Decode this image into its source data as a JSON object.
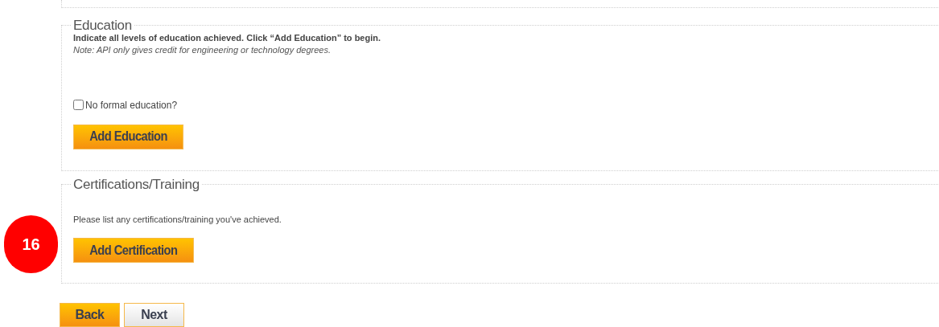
{
  "sections": [
    {
      "legend": "Education",
      "instruction": "Indicate all levels of education achieved. Click “Add Education” to begin.",
      "note": "Note: API only gives credit for engineering or technology degrees.",
      "checkbox": {
        "label": "No formal education?",
        "checked": false
      },
      "button": "Add Education"
    },
    {
      "legend": "Certifications/Training",
      "instruction": "Please list any certifications/training you've achieved.",
      "button": "Add Certification"
    }
  ],
  "step_badge": "16",
  "nav_buttons": [
    {
      "label": "Back",
      "kind": "primary"
    },
    {
      "label": "Next",
      "kind": "secondary"
    }
  ]
}
